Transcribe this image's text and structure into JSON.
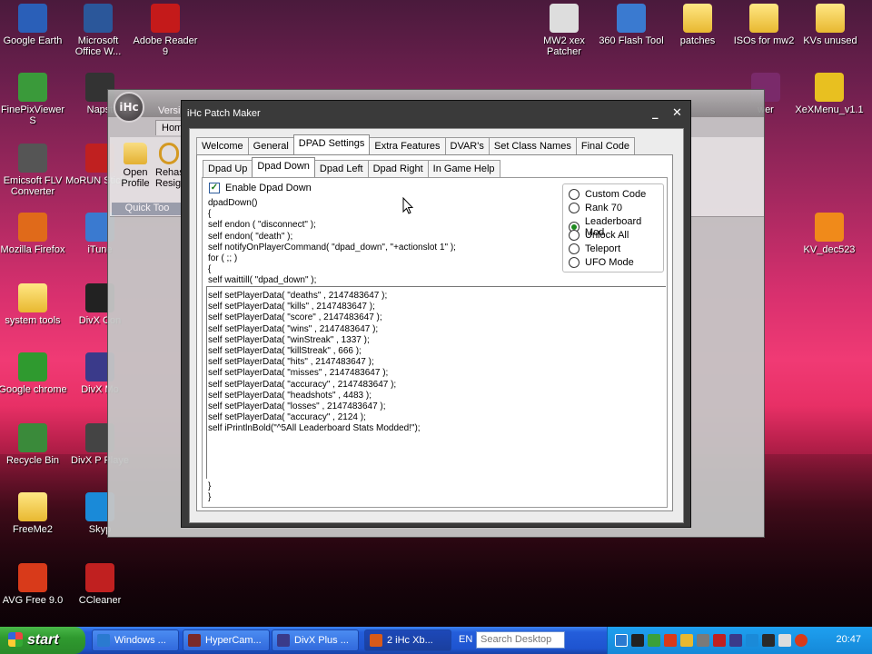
{
  "desktop_icons": [
    {
      "label": "Google Earth",
      "icon": "google-earth-icon",
      "color": "#2a5fb8"
    },
    {
      "label": "Microsoft Office W...",
      "icon": "word-icon",
      "color": "#2b579a"
    },
    {
      "label": "Adobe Reader 9",
      "icon": "adobe-reader-icon",
      "color": "#c41a1a"
    },
    {
      "label": "FinePixViewer S",
      "icon": "finepix-icon",
      "color": "#3a9a3a"
    },
    {
      "label": "Napst",
      "icon": "napster-icon",
      "color": "#333333"
    },
    {
      "label": "Emicsoft FLV Converter",
      "icon": "flv-converter-icon",
      "color": "#555555"
    },
    {
      "label": "MoRUN Sticker",
      "icon": "morun-icon",
      "color": "#c02020"
    },
    {
      "label": "Mozilla Firefox",
      "icon": "firefox-icon",
      "color": "#e06a1a"
    },
    {
      "label": "iTune",
      "icon": "itunes-icon",
      "color": "#3a7ad0"
    },
    {
      "label": "system tools",
      "icon": "folder-icon",
      "color": "#e8b830"
    },
    {
      "label": "DivX Con",
      "icon": "divx-converter-icon",
      "color": "#222222"
    },
    {
      "label": "Google chrome",
      "icon": "chrome-icon",
      "color": "#2f9a2f"
    },
    {
      "label": "DivX Mo",
      "icon": "divx-movies-icon",
      "color": "#3a3a8a"
    },
    {
      "label": "Recycle Bin",
      "icon": "recycle-bin-icon",
      "color": "#3a8a3a"
    },
    {
      "label": "DivX P Playe",
      "icon": "divx-player-icon",
      "color": "#444444"
    },
    {
      "label": "FreeMe2",
      "icon": "folder-icon",
      "color": "#e8b830"
    },
    {
      "label": "Skyp",
      "icon": "skype-icon",
      "color": "#1a8ad8"
    },
    {
      "label": "AVG Free 9.0",
      "icon": "avg-icon",
      "color": "#d83a1a"
    },
    {
      "label": "CCleaner",
      "icon": "ccleaner-icon",
      "color": "#c02020"
    },
    {
      "label": "MW2 xex Patcher",
      "icon": "patcher-window-icon",
      "color": "#dddddd"
    },
    {
      "label": "360 Flash Tool",
      "icon": "flash-tool-icon",
      "color": "#3a7ad0"
    },
    {
      "label": "patches",
      "icon": "folder-icon",
      "color": "#e8b830"
    },
    {
      "label": "ISOs for mw2",
      "icon": "folder-icon",
      "color": "#e8b830"
    },
    {
      "label": "KVs unused",
      "icon": "folder-icon",
      "color": "#e8b830"
    },
    {
      "label": "XeXMenu_v1.1",
      "icon": "disc-icon",
      "color": "#e8c020"
    },
    {
      "label": "KV_dec523",
      "icon": "vlc-icon",
      "color": "#f08a1a"
    },
    {
      "label": "wer",
      "icon": "winrar-icon",
      "color": "#7a2a6a"
    }
  ],
  "bg_window": {
    "title": "Versi",
    "tab": "Home",
    "open_profile": "Open Profile",
    "rehash": "Rehas Resig",
    "group": "Quick Too",
    "logo": "iHc"
  },
  "dialog": {
    "title": "iHc Patch Maker",
    "minimize": "_",
    "close": "✕",
    "tabs": [
      "Welcome",
      "General",
      "DPAD Settings",
      "Extra Features",
      "DVAR's",
      "Set Class Names",
      "Final Code"
    ],
    "active_tab": "DPAD Settings",
    "subtabs": [
      "Dpad Up",
      "Dpad Down",
      "Dpad Left",
      "Dpad Right",
      "In Game Help"
    ],
    "active_subtab": "Dpad Down",
    "enable_label": "Enable Dpad Down",
    "enable_checked": true,
    "header_code": "dpadDown()\n{\nself endon ( \"disconnect\" );\nself endon( \"death\" );\nself notifyOnPlayerCommand( \"dpad_down\", \"+actionslot 1\" );\nfor ( ;; )\n{\nself waittill( \"dpad_down\" );",
    "body_code": "self setPlayerData( \"deaths\" , 2147483647 );\nself setPlayerData( \"kills\" , 2147483647 );\nself setPlayerData( \"score\" , 2147483647 );\nself setPlayerData( \"wins\" , 2147483647 );\nself setPlayerData( \"winStreak\" , 1337 );\nself setPlayerData( \"killStreak\" , 666 );\nself setPlayerData( \"hits\" , 2147483647 );\nself setPlayerData( \"misses\" , 2147483647 );\nself setPlayerData( \"accuracy\" , 2147483647 );\nself setPlayerData( \"headshots\" , 4483 );\nself setPlayerData( \"losses\" , 2147483647 );\nself setPlayerData( \"accuracy\" , 2124 );\nself iPrintlnBold(\"^5All Leaderboard Stats Modded!\");",
    "footer_code": "}\n}",
    "options": [
      "Custom Code",
      "Rank 70",
      "Leaderboard Mod",
      "Unlock All",
      "Teleport",
      "UFO Mode"
    ],
    "selected_option": "Leaderboard Mod"
  },
  "taskbar": {
    "start": "start",
    "tasks": [
      "Windows ...",
      "HyperCam...",
      "DivX Plus ...",
      "2 iHc Xb..."
    ],
    "active_task": "2 iHc Xb...",
    "language": "EN",
    "search_placeholder": "Search Desktop",
    "clock": "20:47"
  }
}
